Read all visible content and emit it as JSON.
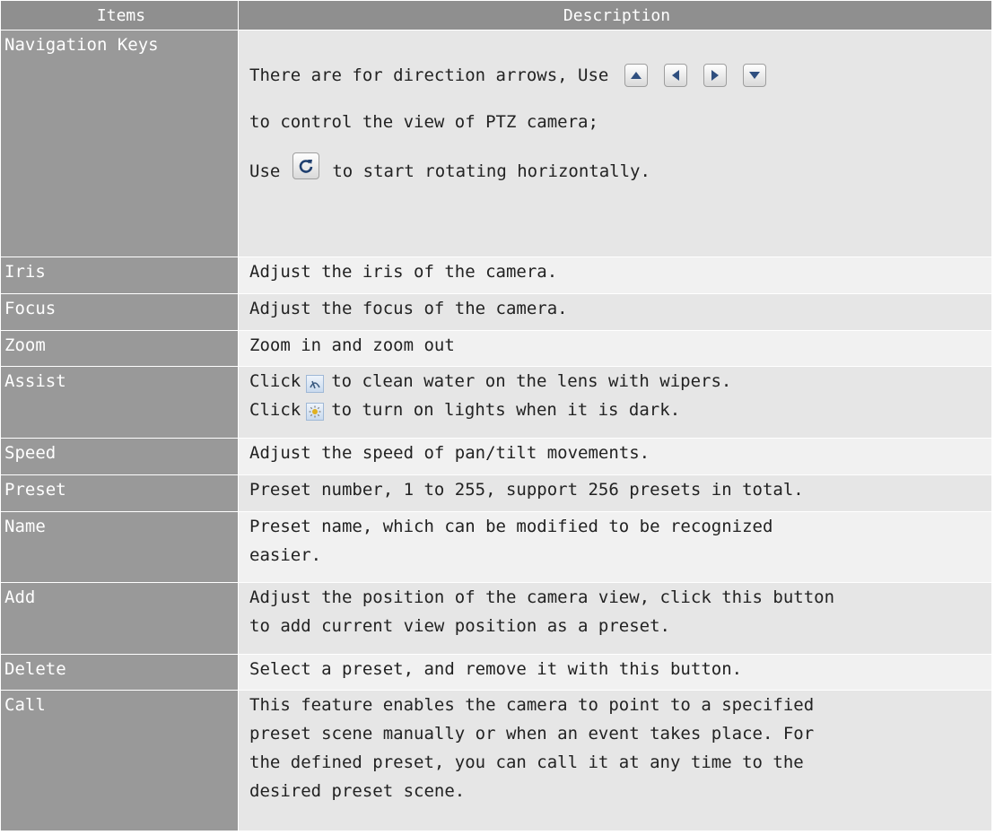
{
  "table": {
    "headers": [
      "Items",
      "Description"
    ],
    "nav": {
      "item": "Navigation Keys",
      "line1": "There are for direction arrows, Use",
      "line2": "to control the view of PTZ camera;",
      "line3_pre": "Use",
      "line3_post": "to start rotating horizontally."
    },
    "icons": {
      "up": "arrow-up-icon",
      "left": "arrow-left-icon",
      "right": "arrow-right-icon",
      "down": "arrow-down-icon",
      "rotate": "rotate-icon",
      "wiper": "wiper-icon",
      "light": "light-icon"
    },
    "rows": [
      {
        "item": "Iris",
        "lines": [
          "Adjust the iris of the camera."
        ]
      },
      {
        "item": "Focus",
        "lines": [
          "Adjust the focus of the camera."
        ]
      },
      {
        "item": "Zoom",
        "lines": [
          "Zoom in and zoom out"
        ]
      },
      {
        "item": "Assist",
        "lines": [
          "Click",
          "to clean water on the lens with wipers.",
          "Click",
          "to turn on lights when it is dark."
        ]
      },
      {
        "item": "Speed",
        "lines": [
          "Adjust the speed of pan/tilt movements."
        ]
      },
      {
        "item": "Preset",
        "lines": [
          "Preset number, 1 to 255, support 256 presets in total."
        ]
      },
      {
        "item": "Name",
        "lines": [
          "Preset name, which can be modified to be recognized",
          "easier."
        ]
      },
      {
        "item": "Add",
        "lines": [
          "Adjust the position of the camera view, click this button",
          "to add current view position as a preset."
        ]
      },
      {
        "item": "Delete",
        "lines": [
          "Select a preset, and remove it with this button."
        ]
      },
      {
        "item": "Call",
        "lines": [
          "This feature enables the camera to point to a specified",
          "preset scene manually or when an event takes place. For",
          "the defined preset, you can call it at any time to the",
          "desired preset scene."
        ]
      }
    ]
  }
}
